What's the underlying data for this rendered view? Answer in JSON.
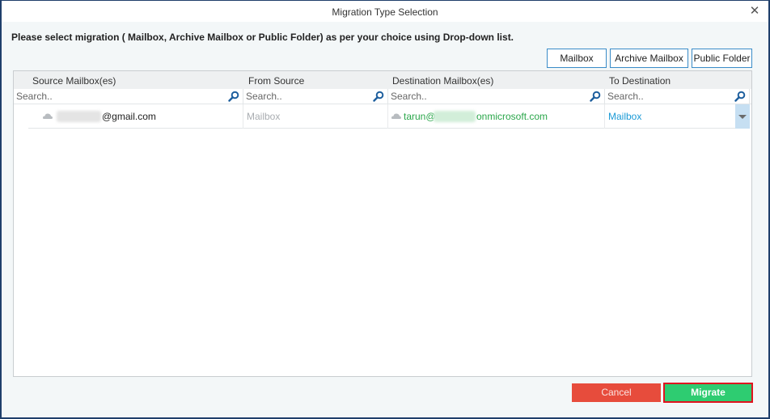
{
  "window": {
    "title": "Migration Type Selection",
    "close_icon": "close-icon"
  },
  "instruction": "Please select migration ( Mailbox, Archive Mailbox or Public Folder) as per your choice using Drop-down list.",
  "type_buttons": [
    {
      "label": "Mailbox"
    },
    {
      "label": "Archive Mailbox"
    },
    {
      "label": "Public Folder"
    }
  ],
  "grid": {
    "columns": [
      {
        "header": "Source Mailbox(es)",
        "search_placeholder": "Search.."
      },
      {
        "header": "From Source",
        "search_placeholder": "Search.."
      },
      {
        "header": "Destination Mailbox(es)",
        "search_placeholder": "Search.."
      },
      {
        "header": "To Destination",
        "search_placeholder": "Search.."
      }
    ],
    "rows": [
      {
        "source_mailbox_suffix": "@gmail.com",
        "from_source": "Mailbox",
        "destination_prefix": "tarun@",
        "destination_suffix": "onmicrosoft.com",
        "to_destination": "Mailbox"
      }
    ]
  },
  "colors": {
    "accent": "#3a8cc8",
    "destination_text": "#2aa64a",
    "to_destination_text": "#1b9ad6",
    "cancel": "#e74c3c",
    "migrate": "#2ecc71",
    "highlight_border": "#e0141f"
  },
  "footer": {
    "cancel_label": "Cancel",
    "migrate_label": "Migrate"
  }
}
